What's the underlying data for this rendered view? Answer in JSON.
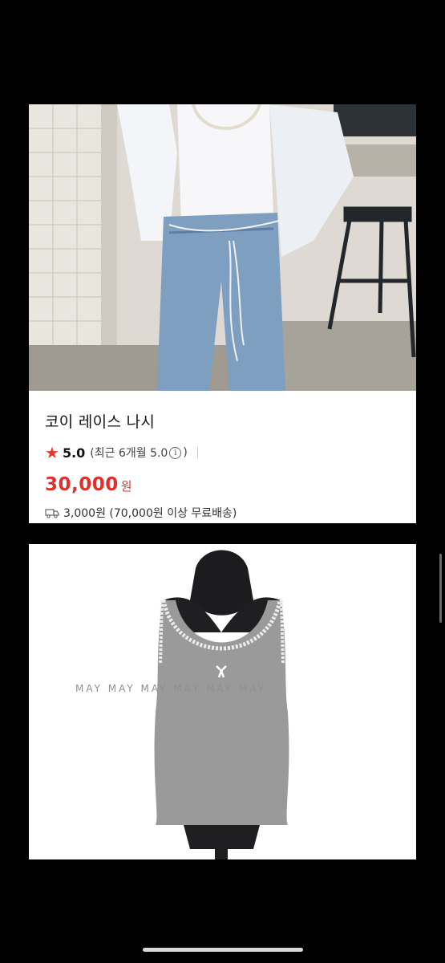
{
  "product": {
    "title": "코이 레이스 나시",
    "rating": "5.0",
    "recent_rating_prefix": "(최근 6개월 5.0",
    "recent_rating_suffix": ")",
    "info_glyph": "i",
    "price": "30,000",
    "price_unit": "원",
    "shipping": "3,000원 (70,000원 이상 무료배송)",
    "star_color": "#e8392c",
    "price_color": "#e0302c"
  },
  "images": {
    "main_photo": "model-wearing-lace-tank-photo",
    "second_photo": "grey-lace-tank-on-mannequin-photo",
    "watermark": "MAY MAY MAY MAY MAY MAY"
  }
}
